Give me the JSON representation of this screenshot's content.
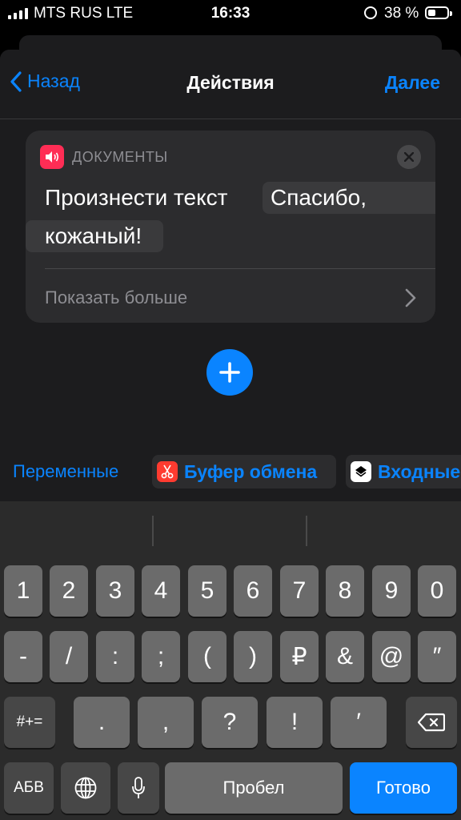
{
  "status_bar": {
    "carrier": "MTS RUS  LTE",
    "time": "16:33",
    "battery": "38 %"
  },
  "nav": {
    "back_label": "Назад",
    "title": "Действия",
    "next_label": "Далее"
  },
  "action_card": {
    "app_name": "ДОКУМЕНТЫ",
    "action_text": "Произнести текст",
    "token_part1": "Спасибо,",
    "token_part2": "кожаный!",
    "show_more": "Показать больше"
  },
  "variables_bar": {
    "variables_label": "Переменные",
    "clipboard_label": "Буфер обмена",
    "input_label": "Входные"
  },
  "keyboard": {
    "row1": [
      "1",
      "2",
      "3",
      "4",
      "5",
      "6",
      "7",
      "8",
      "9",
      "0"
    ],
    "row2": [
      "-",
      "/",
      ":",
      ";",
      "(",
      ")",
      "₽",
      "&",
      "@",
      "″"
    ],
    "row3_left": "#+=",
    "row3": [
      ".",
      ",",
      "?",
      "!",
      "′"
    ],
    "abc_label": "АБВ",
    "space_label": "Пробел",
    "done_label": "Готово"
  },
  "colors": {
    "accent": "#0a84ff",
    "app_icon": "#ff2d55",
    "clipboard_icon": "#ff3b30"
  }
}
